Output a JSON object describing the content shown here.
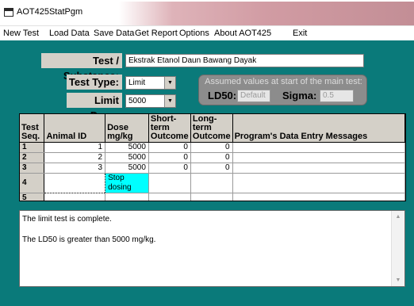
{
  "window": {
    "title": "AOT425StatPgm",
    "icon": "window-icon"
  },
  "menu": [
    "New Test",
    "Load Data",
    "Save Data",
    "Get Report",
    "Options",
    "About AOT425",
    "Exit"
  ],
  "form": {
    "substance_label": "Test / Substance:",
    "substance_value": "Ekstrak Etanol Daun Bawang Dayak",
    "test_type_label": "Test Type:",
    "test_type_value": "Limit",
    "limit_dose_label": "Limit Dose:",
    "limit_dose_value": "5000"
  },
  "assumed": {
    "caption": "Assumed values at start of the main test:",
    "ld50_label": "LD50:",
    "ld50_value": "Default",
    "sigma_label": "Sigma:",
    "sigma_value": "0.5"
  },
  "grid": {
    "headers": [
      "Test Seq.",
      "Animal ID",
      "Dose mg/kg",
      "Short-term Outcome",
      "Long-term Outcome",
      "Program's Data Entry Messages"
    ],
    "rows": [
      [
        "1",
        "1",
        "5000",
        "0",
        "0",
        ""
      ],
      [
        "2",
        "2",
        "5000",
        "0",
        "0",
        ""
      ],
      [
        "3",
        "3",
        "5000",
        "0",
        "0",
        ""
      ],
      [
        "4",
        "",
        "Stop dosing",
        "",
        "",
        ""
      ],
      [
        "5",
        "",
        "",
        "",
        "",
        ""
      ]
    ]
  },
  "messages": [
    "The limit test is complete.",
    "The LD50 is greater than 5000 mg/kg."
  ],
  "colors": {
    "background": "#0a7a7a",
    "highlight": "#00ffff",
    "label_bg": "#d4d0c8"
  }
}
